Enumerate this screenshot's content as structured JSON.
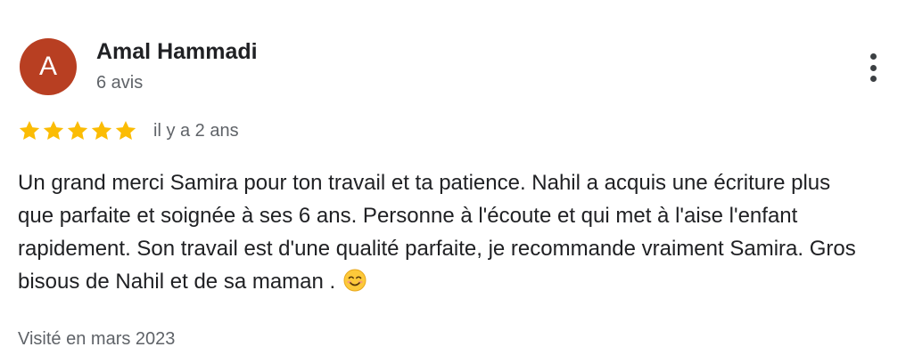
{
  "review": {
    "author": {
      "initial": "A",
      "name": "Amal Hammadi",
      "review_count": "6 avis",
      "avatar_color": "#b83f22"
    },
    "menu_icon": "more-vert-icon",
    "rating": 5,
    "rating_max": 5,
    "star_color": "#fbbc04",
    "time_ago": "il y a 2 ans",
    "text": "Un grand merci Samira pour ton travail et ta patience. Nahil a acquis une écriture plus que parfaite et soignée à ses 6 ans. Personne à l'écoute et qui met à l'aise l'enfant rapidement. Son travail est d'une qualité parfaite, je recommande vraiment Samira. Gros bisous de Nahil et de sa maman . ",
    "emoji_icon": "smiling-face-icon",
    "visited": "Visité en mars 2023"
  }
}
